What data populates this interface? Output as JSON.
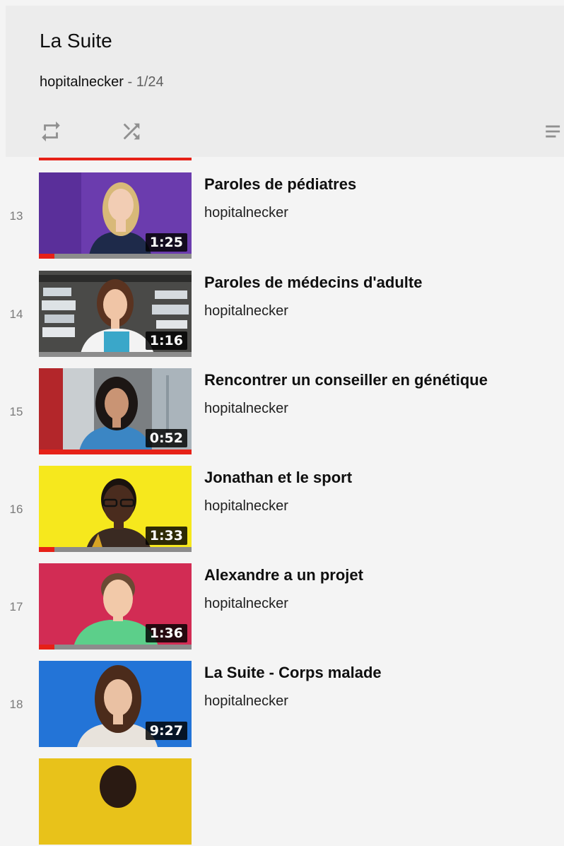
{
  "playlist": {
    "title": "La Suite",
    "channel": "hopitalnecker",
    "position": " - 1/24"
  },
  "controls": {
    "loop_icon": "loop-icon",
    "shuffle_icon": "shuffle-icon",
    "menu_icon": "playlist-menu-icon"
  },
  "colors": {
    "accent": "#e62117",
    "header_bg": "#ececec",
    "page_bg": "#f4f4f4"
  },
  "items": [
    {
      "index": "13",
      "title": "Paroles de pédiatres",
      "channel": "hopitalnecker",
      "duration": "1:25",
      "watched_fraction": 0.1
    },
    {
      "index": "14",
      "title": "Paroles de médecins d'adulte",
      "channel": "hopitalnecker",
      "duration": "1:16",
      "watched_fraction": 0.0
    },
    {
      "index": "15",
      "title": "Rencontrer un conseiller en génétique",
      "channel": "hopitalnecker",
      "duration": "0:52",
      "watched_fraction": 1.0
    },
    {
      "index": "16",
      "title": "Jonathan et le sport",
      "channel": "hopitalnecker",
      "duration": "1:33",
      "watched_fraction": 0.1
    },
    {
      "index": "17",
      "title": "Alexandre a un projet",
      "channel": "hopitalnecker",
      "duration": "1:36",
      "watched_fraction": 0.1
    },
    {
      "index": "18",
      "title": "La Suite - Corps malade",
      "channel": "hopitalnecker",
      "duration": "9:27",
      "watched_fraction": 0.0
    }
  ]
}
